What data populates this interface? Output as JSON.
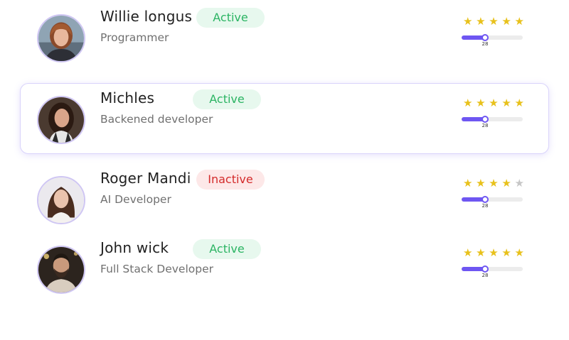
{
  "members": [
    {
      "name": "Willie longus",
      "role": "Programmer",
      "status": "Active",
      "rating": 5,
      "rating_max": 5,
      "progress_value": "28",
      "progress_fraction": 0.38,
      "selected": false,
      "avatar_icon": "woman-short-hair-avatar"
    },
    {
      "name": "Michles",
      "role": "Backened developer",
      "status": "Active",
      "rating": 5,
      "rating_max": 5,
      "progress_value": "28",
      "progress_fraction": 0.38,
      "selected": true,
      "avatar_icon": "woman-dark-hair-avatar"
    },
    {
      "name": "Roger Mandi",
      "role": "AI Developer",
      "status": "Inactive",
      "rating": 4,
      "rating_max": 5,
      "progress_value": "28",
      "progress_fraction": 0.38,
      "selected": false,
      "avatar_icon": "woman-long-hair-avatar"
    },
    {
      "name": "John wick",
      "role": "Full Stack Developer",
      "status": "Active",
      "rating": 5,
      "rating_max": 5,
      "progress_value": "28",
      "progress_fraction": 0.38,
      "selected": false,
      "avatar_icon": "bearded-man-avatar"
    }
  ],
  "colors": {
    "active_text": "#2bb463",
    "active_bg": "#e7f8ee",
    "inactive_text": "#d42b2b",
    "inactive_bg": "#fde8e8",
    "star_on": "#e8c11b",
    "star_off": "#c6c6c6",
    "slider_accent": "#6e56f2",
    "selected_border": "#d9d3fb"
  }
}
